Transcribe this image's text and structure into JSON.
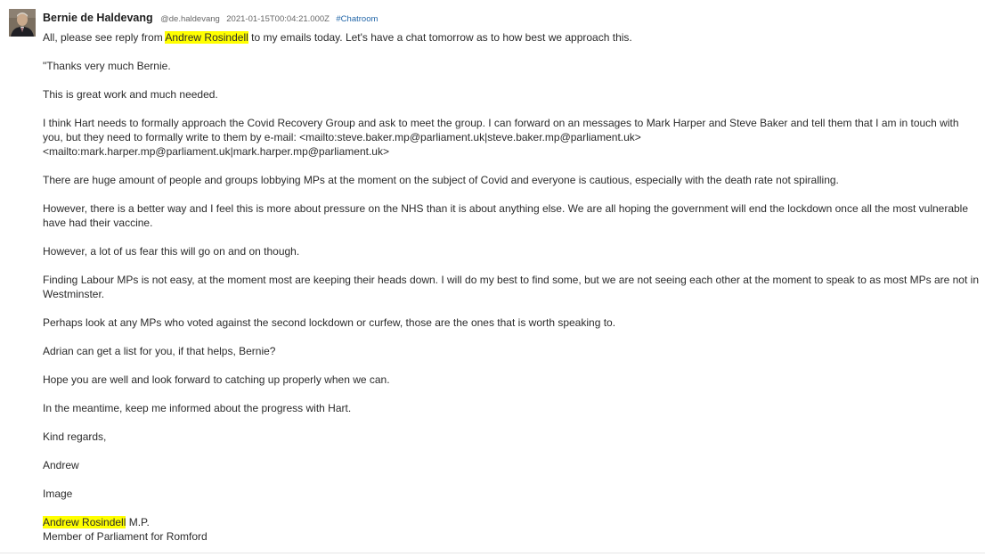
{
  "message": {
    "avatar_icon": "user-avatar-photo",
    "author": "Bernie de Haldevang",
    "handle": "@de.haldevang",
    "timestamp": "2021-01-15T00:04:21.000Z",
    "channel": "#Chatroom",
    "highlight_color": "#ffff00",
    "intro": {
      "before": "All, please see reply from ",
      "highlight": "Andrew Rosindell",
      "after": " to my emails today. Let's have a chat tomorrow as to how best we approach this."
    },
    "paragraphs": [
      "\"Thanks very much Bernie.",
      "This is great work and much needed.",
      "I think Hart needs to formally approach the Covid Recovery Group and ask to meet the group. I can forward on an messages to Mark Harper and Steve Baker and tell them that I am in touch with you, but they need to formally write to them by e-mail: <mailto:steve.baker.mp@parliament.uk|steve.baker.mp@parliament.uk> <mailto:mark.harper.mp@parliament.uk|mark.harper.mp@parliament.uk>",
      "There are huge amount of people and groups lobbying MPs at the moment on the subject of Covid and everyone is cautious, especially with the death rate not spiralling.",
      "However, there is a better way and I feel this is more about pressure on the NHS than it is about anything else.  We are all hoping the government will end the lockdown once all the most vulnerable have had their vaccine.",
      "However, a lot of us fear this will go on and on though.",
      "Finding Labour MPs is not easy, at the moment most are keeping their heads down.  I will do my best to find some, but we are not seeing each other at the moment to speak to as most MPs are not in Westminster.",
      "Perhaps look at any MPs who voted against the second lockdown or curfew, those are the ones that is worth speaking to.",
      "Adrian can get a list for you, if that helps, Bernie?",
      "Hope you are well and look forward to catching up properly when we can.",
      "In the meantime, keep me informed about the progress with Hart.",
      "Kind regards,",
      "Andrew",
      "Image"
    ],
    "signature": {
      "name": "Andrew Rosindell",
      "suffix": " M.P.",
      "title": "Member of Parliament for Romford"
    }
  }
}
